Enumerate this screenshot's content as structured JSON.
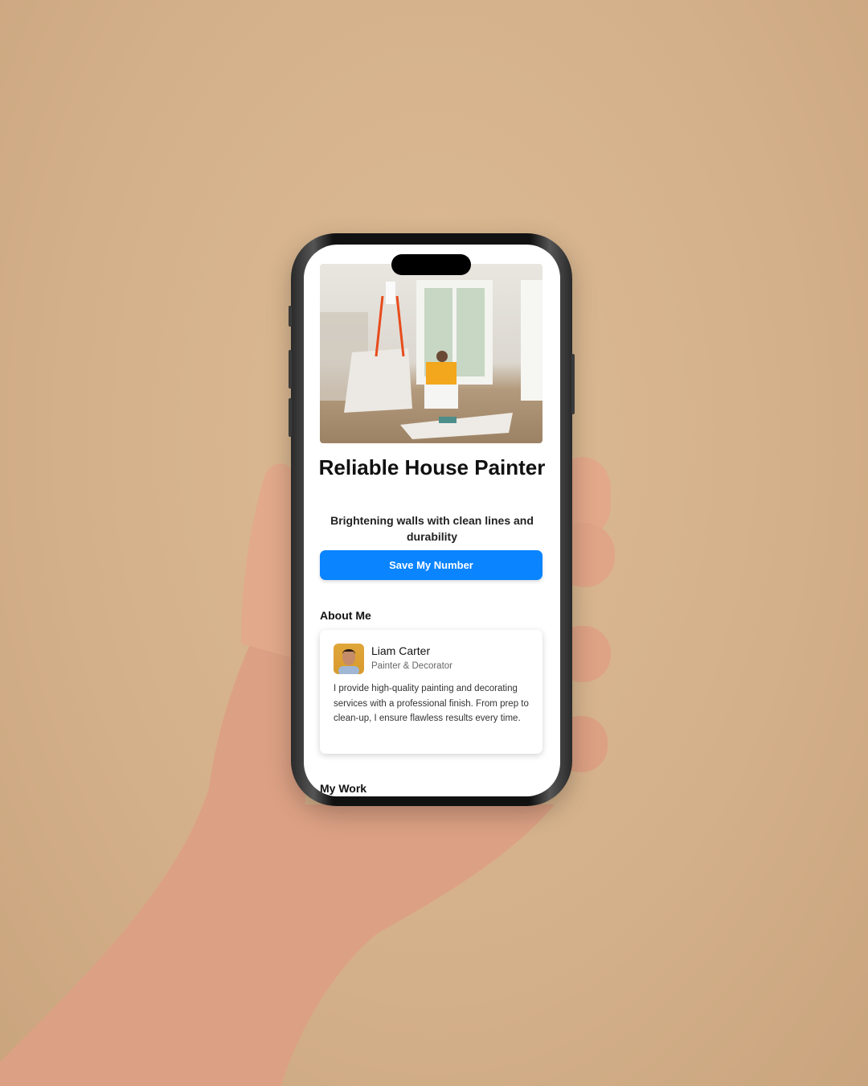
{
  "hero": {
    "image_alt": "painters working in a bright room"
  },
  "title": "Reliable House Painter",
  "subtitle": "Brightening walls with clean lines and durability",
  "save_button": "Save My Number",
  "about": {
    "heading": "About Me",
    "name": "Liam Carter",
    "role": "Painter & Decorator",
    "bio": "I provide high-quality painting and decorating services with a professional finish. From prep to clean-up, I ensure flawless results every time."
  },
  "my_work": {
    "heading": "My Work"
  },
  "colors": {
    "accent": "#0a84ff",
    "background": "#d4b08a"
  }
}
